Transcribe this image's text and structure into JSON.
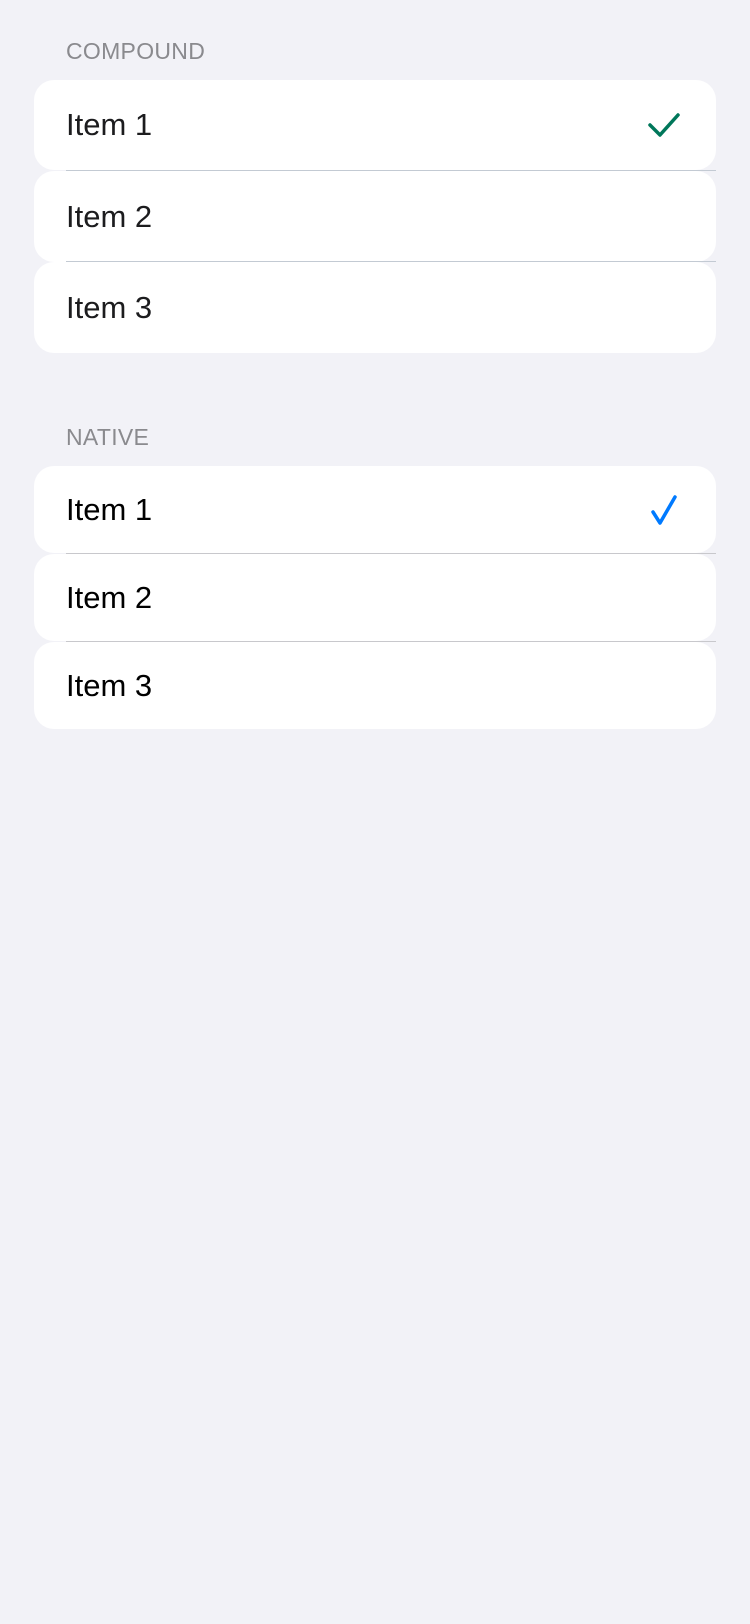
{
  "sections": [
    {
      "header": "COMPOUND",
      "items": [
        {
          "label": "Item 1",
          "selected": true
        },
        {
          "label": "Item 2",
          "selected": false
        },
        {
          "label": "Item 3",
          "selected": false
        }
      ],
      "check_color": "#00775a",
      "separator_color": "#c3cad3"
    },
    {
      "header": "NATIVE",
      "items": [
        {
          "label": "Item 1",
          "selected": true
        },
        {
          "label": "Item 2",
          "selected": false
        },
        {
          "label": "Item 3",
          "selected": false
        }
      ],
      "check_color": "#007aff",
      "separator_color": "#c8c8cc"
    }
  ]
}
